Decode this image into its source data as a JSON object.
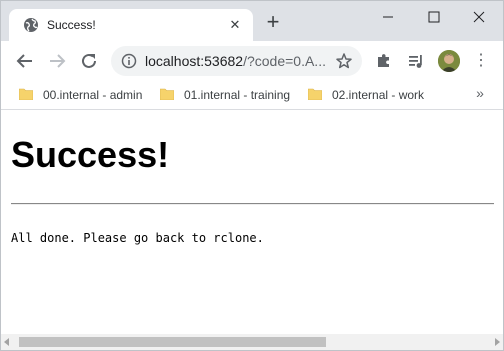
{
  "browser": {
    "tab_title": "Success!",
    "url_host": "localhost:53682",
    "url_rest": "/?code=0.A...",
    "colors": {
      "chrome": "#dee1e6",
      "omnibox": "#f1f3f4",
      "folder": "#f6d36b"
    }
  },
  "bookmarks": [
    {
      "label": "00.internal - admin"
    },
    {
      "label": "01.internal - training"
    },
    {
      "label": "02.internal - work"
    }
  ],
  "page": {
    "heading": "Success!",
    "message": "All done. Please go back to rclone."
  }
}
